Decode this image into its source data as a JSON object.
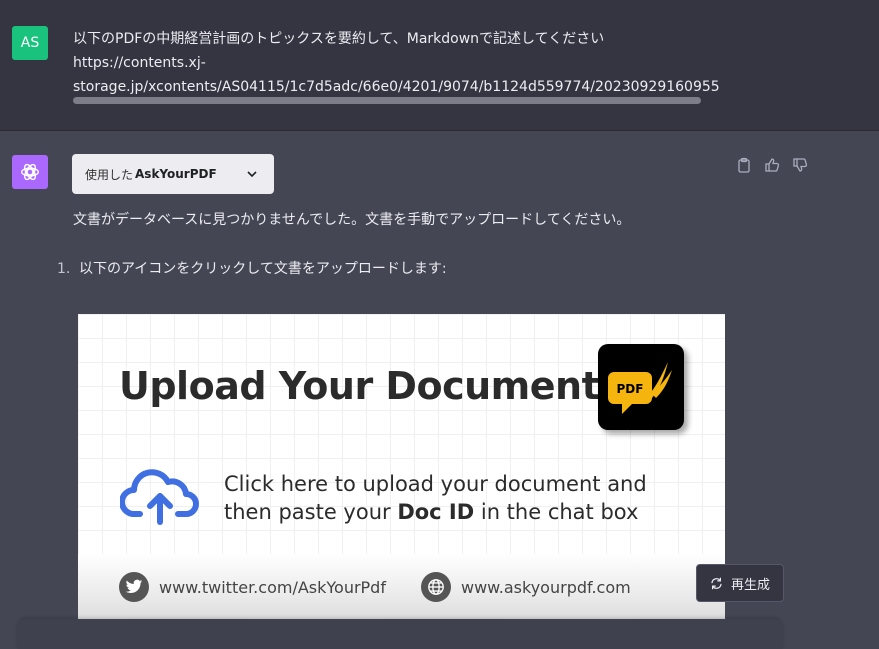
{
  "user": {
    "avatar": "AS",
    "prompt": "以下のPDFの中期経営計画のトピックスを要約して、Markdownで記述してください",
    "url_line1": "https://contents.xj-",
    "url_line2": "storage.jp/xcontents/AS04115/1c7d5adc/66e0/4201/9074/b1124d559774/20230929160955"
  },
  "assistant": {
    "plugin_prefix": "使用した",
    "plugin_name": "AskYourPDF",
    "message": "文書がデータベースに見つかりませんでした。文書を手動でアップロードしてください。",
    "list": [
      {
        "num": "1.",
        "text": "以下のアイコンをクリックして文書をアップロードします:"
      }
    ],
    "actions": [
      "clipboard-icon",
      "thumbs-up-icon",
      "thumbs-down-icon"
    ]
  },
  "banner": {
    "title": "Upload Your Document",
    "logo_text": "PDF",
    "cta_line1": "Click here to upload your document and",
    "cta_line2_pre": "then paste your ",
    "cta_line2_bold": "Doc ID",
    "cta_line2_post": " in the chat box",
    "twitter": "www.twitter.com/AskYourPdf",
    "website": "www.askyourpdf.com"
  },
  "regenerate_label": "再生成",
  "colors": {
    "user_bg": "#343541",
    "assistant_bg": "#444654",
    "user_avatar": "#19c37d",
    "gpt_avatar": "#ab68ff",
    "logo_yellow": "#f6b40e",
    "cloud_blue": "#3f6fe0"
  }
}
